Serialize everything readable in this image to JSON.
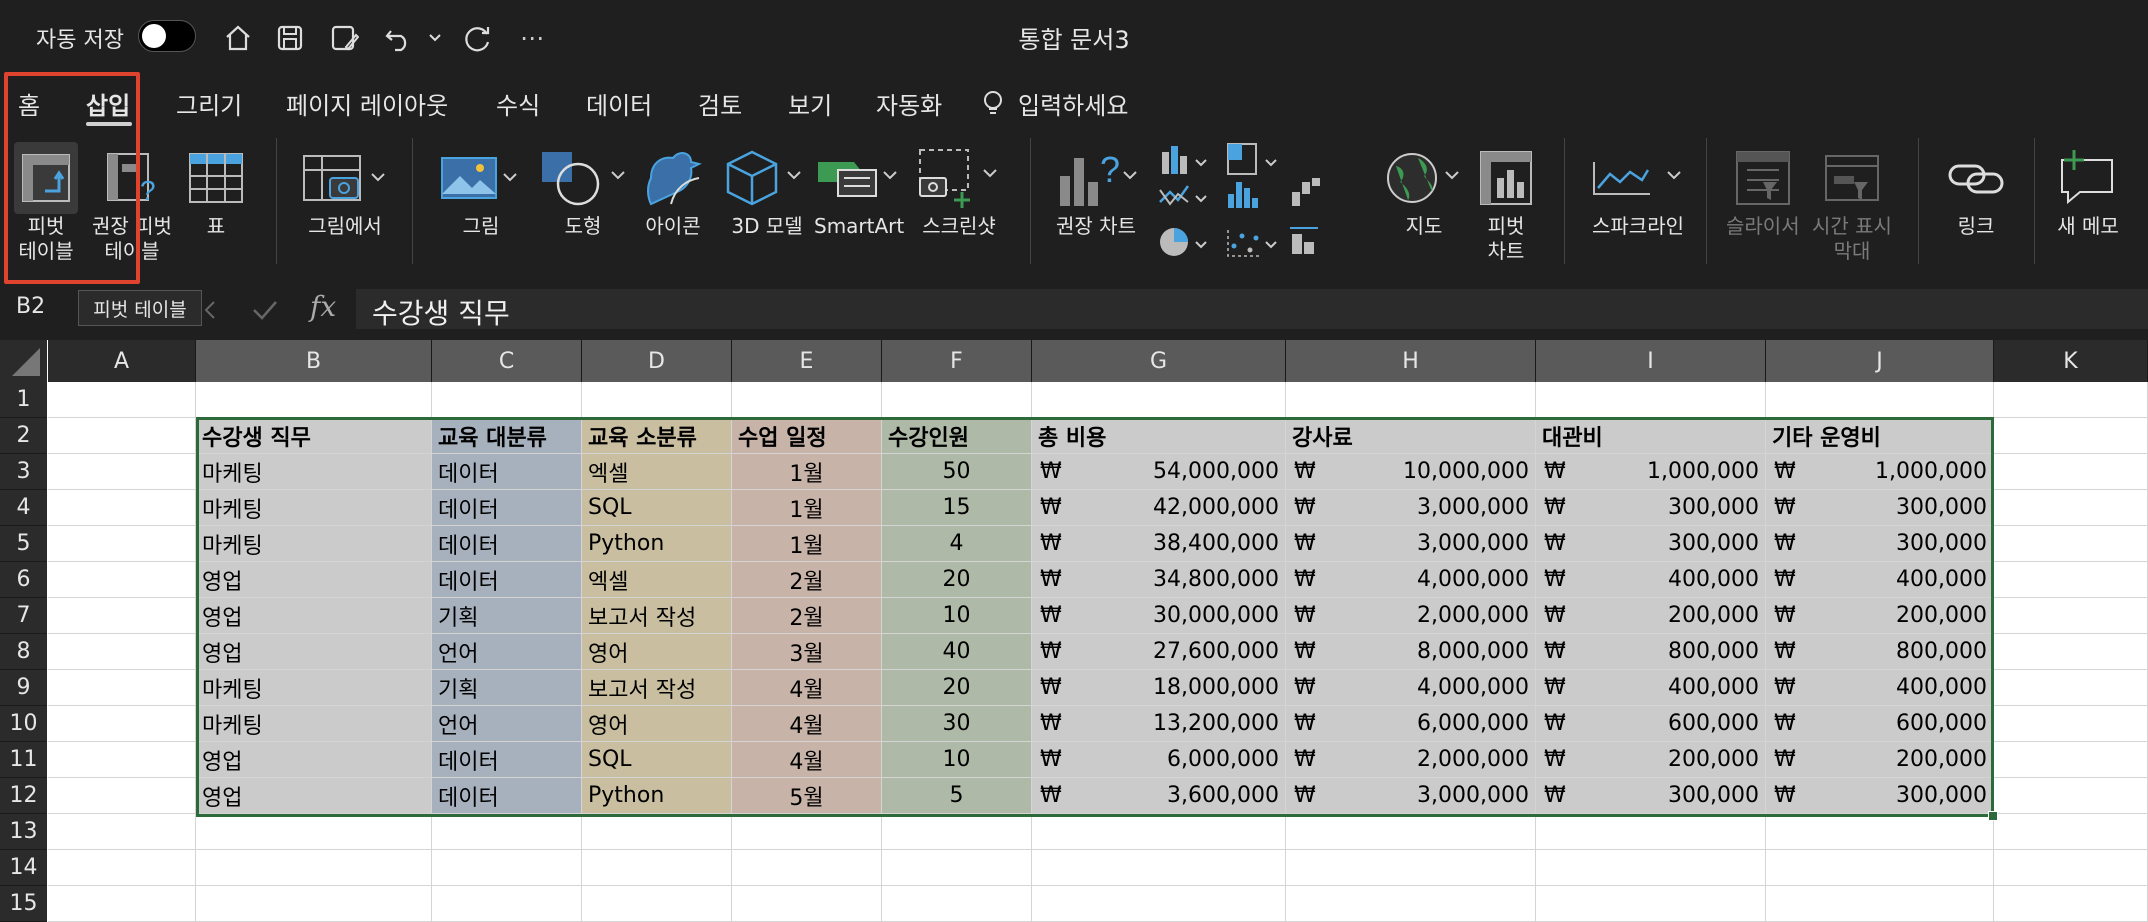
{
  "title_bar": {
    "autosave_label": "자동 저장",
    "document_title": "통합 문서3",
    "icons": [
      "home-icon",
      "save-icon",
      "save-as-icon",
      "undo-icon",
      "dropdown-icon",
      "redo-icon",
      "more-icon"
    ]
  },
  "tabs": [
    {
      "label": "홈",
      "active": false
    },
    {
      "label": "삽입",
      "active": true
    },
    {
      "label": "그리기",
      "active": false
    },
    {
      "label": "페이지 레이아웃",
      "active": false
    },
    {
      "label": "수식",
      "active": false
    },
    {
      "label": "데이터",
      "active": false
    },
    {
      "label": "검토",
      "active": false
    },
    {
      "label": "보기",
      "active": false
    },
    {
      "label": "자동화",
      "active": false
    }
  ],
  "tell_me": "입력하세요",
  "ribbon": {
    "pivot_table": "피벗\n테이블",
    "recommended_pivot": "권장 피벗\n테이블",
    "table": "표",
    "picture_from": "그림에서",
    "picture": "그림",
    "shapes": "도형",
    "icons": "아이콘",
    "models_3d": "3D 모델",
    "smartart": "SmartArt",
    "screenshot": "스크린샷",
    "recommended_charts": "권장 차트",
    "map": "지도",
    "pivot_chart": "피벗\n차트",
    "sparklines": "스파크라인",
    "slicer": "슬라이서",
    "timeline": "시간 표시\n막대",
    "link": "링크",
    "new_note": "새 메모"
  },
  "formula_bar": {
    "name_box": "B2",
    "tooltip": "피벗 테이블",
    "fx": "fx",
    "formula": "수강생 직무"
  },
  "columns": [
    "A",
    "B",
    "C",
    "D",
    "E",
    "F",
    "G",
    "H",
    "I",
    "J",
    "K"
  ],
  "rows": [
    "1",
    "2",
    "3",
    "4",
    "5",
    "6",
    "7",
    "8",
    "9",
    "10",
    "11",
    "12",
    "13",
    "14",
    "15"
  ],
  "colors": {
    "col_b": "#cbcbcb",
    "col_c": "#a7b1be",
    "col_d": "#c9bfa0",
    "col_e": "#c8b3a8",
    "col_f": "#aebaa7",
    "col_money": "#cbcbcb",
    "selection": "#2d6a3a",
    "highlight": "#e0432d"
  },
  "table": {
    "headers": [
      "수강생 직무",
      "교육 대분류",
      "교육 소분류",
      "수업 일정",
      "수강인원",
      "총 비용",
      "강사료",
      "대관비",
      "기타 운영비"
    ],
    "currency": "₩",
    "rows": [
      [
        "마케팅",
        "데이터",
        "엑셀",
        "1월",
        "50",
        "54,000,000",
        "10,000,000",
        "1,000,000",
        "1,000,000"
      ],
      [
        "마케팅",
        "데이터",
        "SQL",
        "1월",
        "15",
        "42,000,000",
        "3,000,000",
        "300,000",
        "300,000"
      ],
      [
        "마케팅",
        "데이터",
        "Python",
        "1월",
        "4",
        "38,400,000",
        "3,000,000",
        "300,000",
        "300,000"
      ],
      [
        "영업",
        "데이터",
        "엑셀",
        "2월",
        "20",
        "34,800,000",
        "4,000,000",
        "400,000",
        "400,000"
      ],
      [
        "영업",
        "기획",
        "보고서 작성",
        "2월",
        "10",
        "30,000,000",
        "2,000,000",
        "200,000",
        "200,000"
      ],
      [
        "영업",
        "언어",
        "영어",
        "3월",
        "40",
        "27,600,000",
        "8,000,000",
        "800,000",
        "800,000"
      ],
      [
        "마케팅",
        "기획",
        "보고서 작성",
        "4월",
        "20",
        "18,000,000",
        "4,000,000",
        "400,000",
        "400,000"
      ],
      [
        "마케팅",
        "언어",
        "영어",
        "4월",
        "30",
        "13,200,000",
        "6,000,000",
        "600,000",
        "600,000"
      ],
      [
        "영업",
        "데이터",
        "SQL",
        "4월",
        "10",
        "6,000,000",
        "2,000,000",
        "200,000",
        "200,000"
      ],
      [
        "영업",
        "데이터",
        "Python",
        "5월",
        "5",
        "3,600,000",
        "3,000,000",
        "300,000",
        "300,000"
      ]
    ]
  }
}
